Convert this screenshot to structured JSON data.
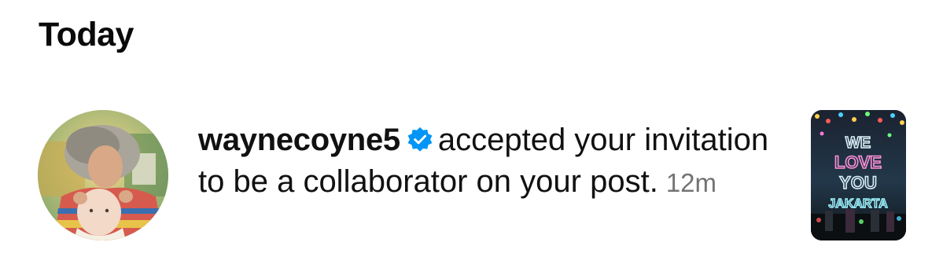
{
  "section": {
    "title": "Today"
  },
  "notification": {
    "username": "waynecoyne5",
    "verified_icon": "verified-badge-icon",
    "message": "accepted your invitation to be a collaborator on your post.",
    "time": "12m",
    "avatar": "profile-photo",
    "post_thumbnail": {
      "image": "concert-stage-photo",
      "text": "WE LOVE YOU JAKARTA"
    }
  },
  "colors": {
    "verified_blue": "#0095f6",
    "timestamp_gray": "#737373",
    "text": "#111111"
  }
}
